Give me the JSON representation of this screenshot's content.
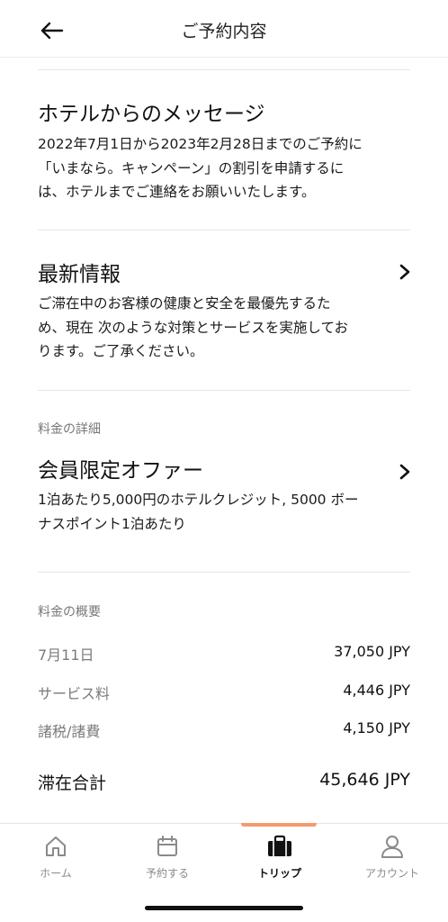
{
  "header": {
    "title": "ご予約内容"
  },
  "message": {
    "title": "ホテルからのメッセージ",
    "lines": [
      "2022年7月1日から2023年2月28日までのご予約に",
      "「いまなら。キャンペーン」の割引を申請するに",
      "は、ホテルまでご連絡をお願いいたします。"
    ]
  },
  "news": {
    "title": "最新情報",
    "lines": [
      "ご滞在中のお客様の健康と安全を最優先するた",
      "め、現在 次のような対策とサービスを実施してお",
      "ります。ご了承ください。"
    ]
  },
  "rate_details": {
    "label": "料金の詳細",
    "title": "会員限定オファー",
    "lines": [
      "1泊あたり5,000円のホテルクレジット, 5000 ボー",
      "ナスポイント1泊あたり"
    ]
  },
  "summary": {
    "label": "料金の概要",
    "rows": [
      {
        "label": "7月11日",
        "value": "37,050 JPY"
      },
      {
        "label": "サービス料",
        "value": "4,446 JPY"
      },
      {
        "label": "諸税/諸費",
        "value": "4,150 JPY"
      }
    ],
    "total_label": "滞在合計",
    "total_value": "45,646 JPY"
  },
  "tabs": [
    {
      "label": "ホーム",
      "icon": "home-icon"
    },
    {
      "label": "予約する",
      "icon": "calendar-icon"
    },
    {
      "label": "トリップ",
      "icon": "briefcase-icon"
    },
    {
      "label": "アカウント",
      "icon": "person-icon"
    }
  ],
  "colors": {
    "accent": "#f59a6c",
    "text": "#111111",
    "muted": "#7a7a7a",
    "divider": "#e6e6e6"
  }
}
